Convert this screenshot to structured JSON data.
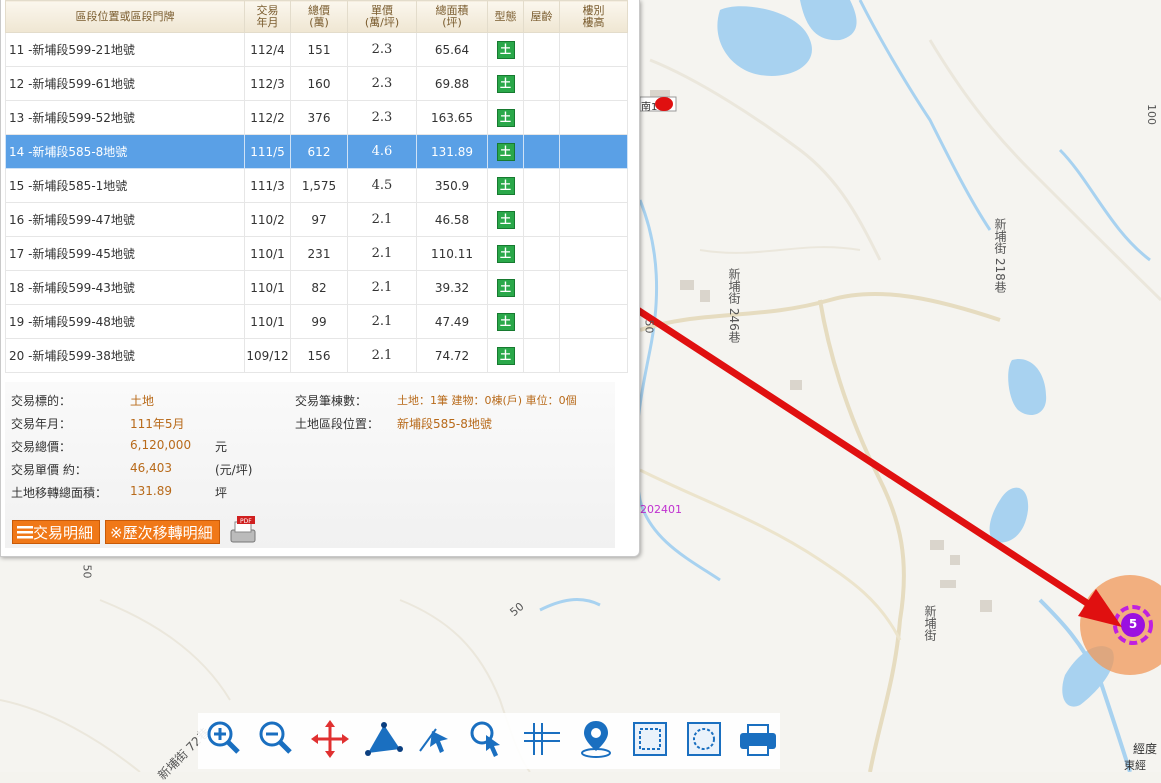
{
  "table": {
    "headers": [
      "區段位置或區段門牌",
      "交易\n年月",
      "總價\n(萬)",
      "單價\n(萬/坪)",
      "總面積\n(坪)",
      "型態",
      "屋齡",
      "樓別\n樓高"
    ],
    "rows": [
      {
        "addr": "11 -新埔段599-21地號",
        "date": "112/4",
        "total": "151",
        "unit": "2.3",
        "area": "65.64",
        "type": "土"
      },
      {
        "addr": "12 -新埔段599-61地號",
        "date": "112/3",
        "total": "160",
        "unit": "2.3",
        "area": "69.88",
        "type": "土"
      },
      {
        "addr": "13 -新埔段599-52地號",
        "date": "112/2",
        "total": "376",
        "unit": "2.3",
        "area": "163.65",
        "type": "土"
      },
      {
        "addr": "14 -新埔段585-8地號",
        "date": "111/5",
        "total": "612",
        "unit": "4.6",
        "area": "131.89",
        "type": "土"
      },
      {
        "addr": "15 -新埔段585-1地號",
        "date": "111/3",
        "total": "1,575",
        "unit": "4.5",
        "area": "350.9",
        "type": "土"
      },
      {
        "addr": "16 -新埔段599-47地號",
        "date": "110/2",
        "total": "97",
        "unit": "2.1",
        "area": "46.58",
        "type": "土"
      },
      {
        "addr": "17 -新埔段599-45地號",
        "date": "110/1",
        "total": "231",
        "unit": "2.1",
        "area": "110.11",
        "type": "土"
      },
      {
        "addr": "18 -新埔段599-43地號",
        "date": "110/1",
        "total": "82",
        "unit": "2.1",
        "area": "39.32",
        "type": "土"
      },
      {
        "addr": "19 -新埔段599-48地號",
        "date": "110/1",
        "total": "99",
        "unit": "2.1",
        "area": "47.49",
        "type": "土"
      },
      {
        "addr": "20 -新埔段599-38地號",
        "date": "109/12",
        "total": "156",
        "unit": "2.1",
        "area": "74.72",
        "type": "土"
      }
    ],
    "selected_index": 3
  },
  "detail": {
    "target_label": "交易標的：",
    "target_value": "土地",
    "date_label": "交易年月：",
    "date_value": "111年5月",
    "total_label": "交易總價：",
    "total_value": "6,120,000",
    "total_unit": "元",
    "unit_label": "交易單價 約：",
    "unit_value": "46,403",
    "unit_unit": "(元/坪)",
    "area_label": "土地移轉總面積：",
    "area_value": "131.89",
    "area_unit": "坪",
    "count_label": "交易筆棟數：",
    "count_value": "土地：1筆 建物：0棟(戶) 車位：0個",
    "location_label": "土地區段位置：",
    "location_value": "新埔段585-8地號"
  },
  "buttons": {
    "detail": "交易明細",
    "history": "※歷次移轉明細"
  },
  "map": {
    "labels": {
      "road_246": "新埔街 246巷",
      "road_218": "新埔街 218巷",
      "road_main": "新埔街",
      "road_72": "新埔街 72巷",
      "num_50a": "50",
      "num_50b": "50",
      "num_50c": "50",
      "num_100": "100",
      "code": "202401",
      "pin_text": "南1"
    },
    "cluster_count": "5",
    "corner_text": "經度",
    "corner_text2": "東經"
  },
  "colors": {
    "accent": "#f07818",
    "selected_row": "#5aa0e6",
    "arrow": "#e01010",
    "cluster": "#9b10e0"
  }
}
